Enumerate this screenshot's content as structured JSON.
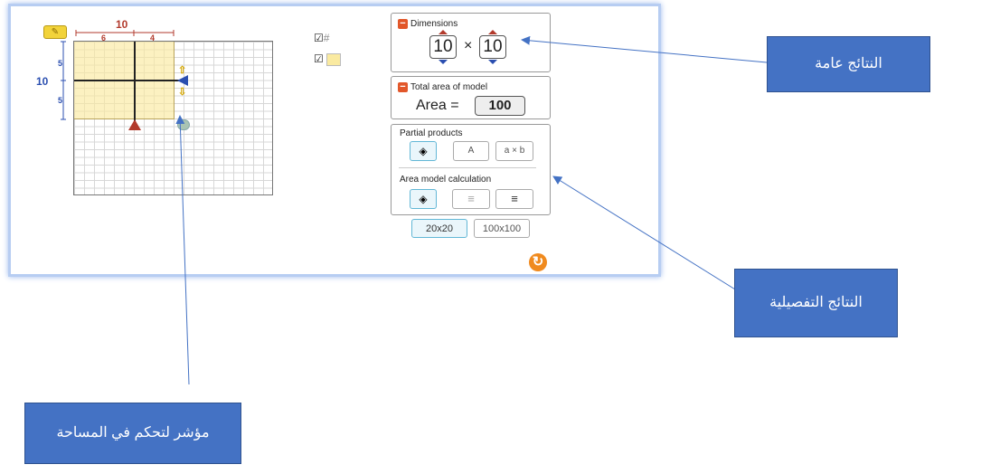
{
  "sim": {
    "ruler_top_total": "10",
    "ruler_top_left": "6",
    "ruler_top_right": "4",
    "ruler_left_total": "10",
    "ruler_left_top": "5",
    "ruler_left_bottom": "5",
    "toggle_icons": [
      "grid-icon",
      "color-icon"
    ]
  },
  "dimensions": {
    "title": "Dimensions",
    "width": "10",
    "times": "×",
    "height": "10"
  },
  "total_area": {
    "title": "Total area of model",
    "label": "Area =",
    "value": "100"
  },
  "options": {
    "partial_products_label": "Partial products",
    "pp_a": "A",
    "pp_axb": "a × b",
    "calc_label": "Area model calculation"
  },
  "grid_size": {
    "option1": "20x20",
    "option2": "100x100",
    "selected": "20x20"
  },
  "callouts": {
    "general_results": "النتائج عامة",
    "detailed_results": "النتائج  التفصيلية",
    "area_control": "مؤشر لتحكم في المساحة"
  },
  "colors": {
    "accent": "#4472c4",
    "panel_minus": "#e2572a",
    "highlight": "#faeaa0"
  }
}
